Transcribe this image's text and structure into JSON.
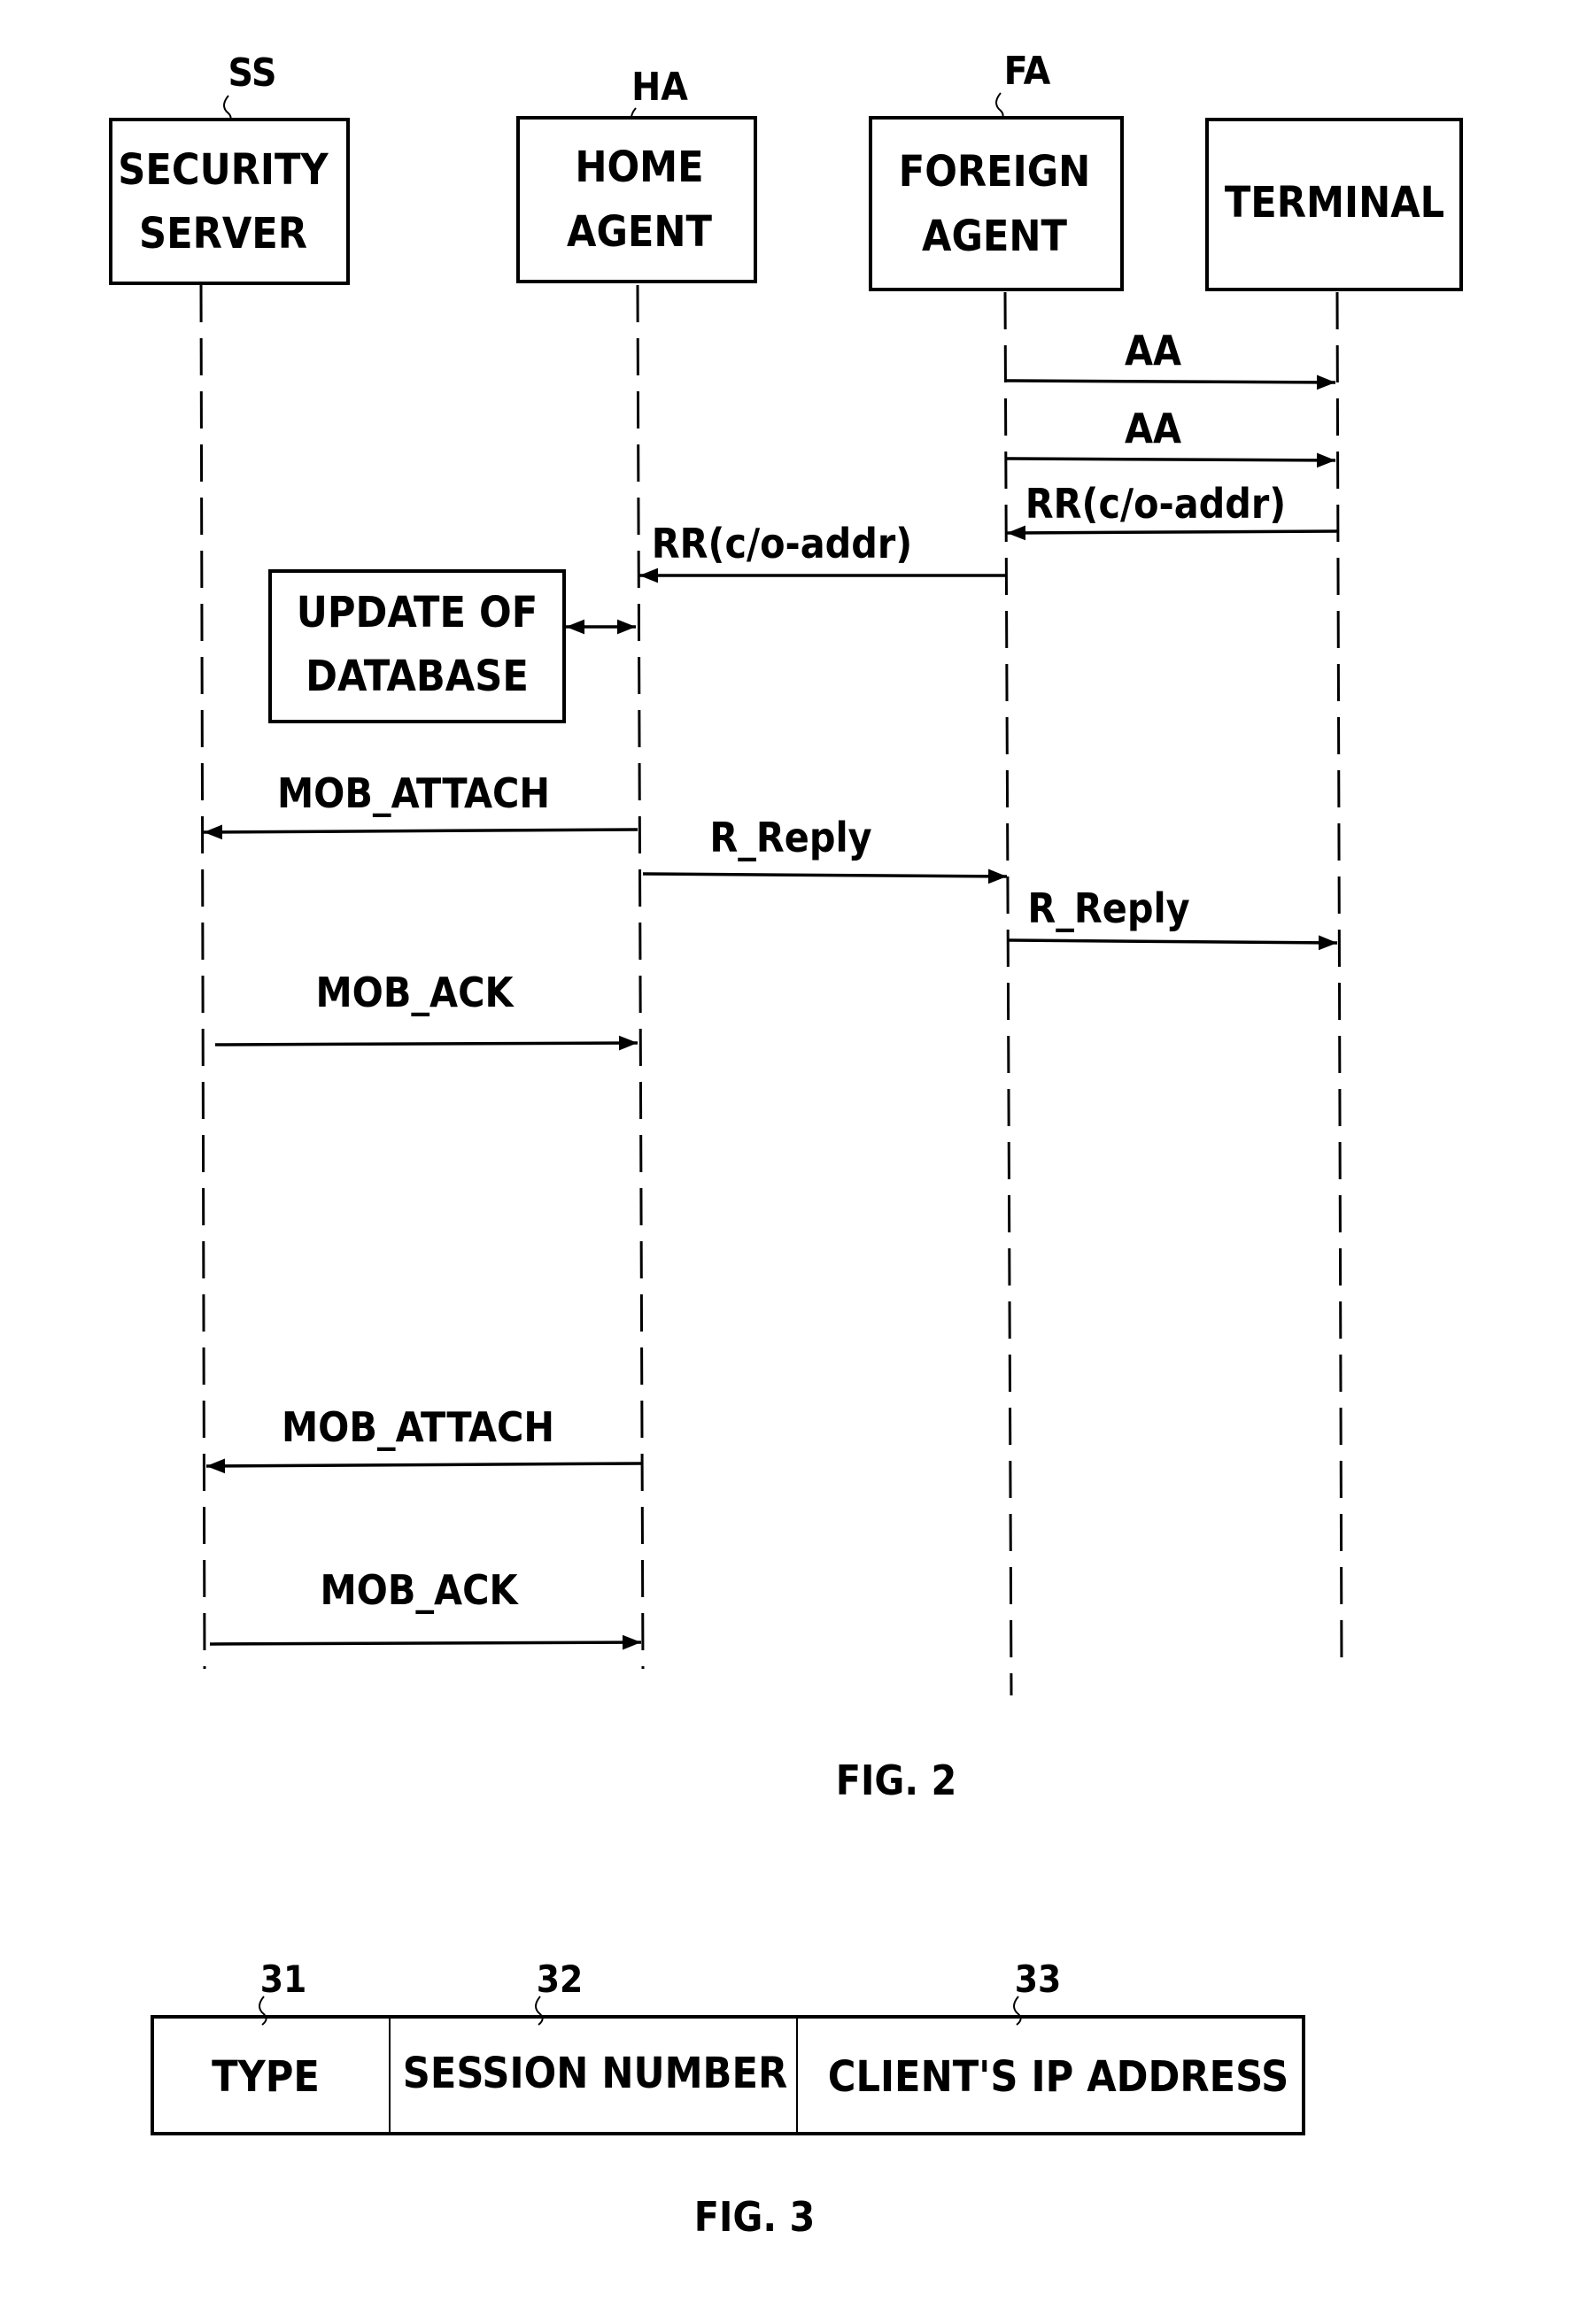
{
  "fig2": {
    "caption": "FIG. 2",
    "entities": [
      {
        "id": "ss",
        "ref": "SS",
        "lines": [
          "SECURITY",
          "SERVER"
        ]
      },
      {
        "id": "ha",
        "ref": "HA",
        "lines": [
          "HOME",
          "AGENT"
        ]
      },
      {
        "id": "fa",
        "ref": "FA",
        "lines": [
          "FOREIGN",
          "AGENT"
        ]
      },
      {
        "id": "terminal",
        "ref": "",
        "lines": [
          "TERMINAL"
        ]
      }
    ],
    "database_box": {
      "lines": [
        "UPDATE OF",
        "DATABASE"
      ],
      "connects_to": "ha"
    },
    "messages": [
      {
        "label": "AA",
        "from": "fa",
        "to": "terminal"
      },
      {
        "label": "AA",
        "from": "fa",
        "to": "terminal"
      },
      {
        "label": "RR(c/o-addr)",
        "from": "terminal",
        "to": "fa"
      },
      {
        "label": "RR(c/o-addr)",
        "from": "fa",
        "to": "ha"
      },
      {
        "label": "MOB_ATTACH",
        "from": "ha",
        "to": "ss"
      },
      {
        "label": "R_Reply",
        "from": "ha",
        "to": "fa"
      },
      {
        "label": "R_Reply",
        "from": "fa",
        "to": "terminal"
      },
      {
        "label": "MOB_ACK",
        "from": "ss",
        "to": "ha"
      },
      {
        "label": "MOB_ATTACH",
        "from": "ha",
        "to": "ss"
      },
      {
        "label": "MOB_ACK",
        "from": "ss",
        "to": "ha"
      }
    ]
  },
  "fig3": {
    "caption": "FIG. 3",
    "fields": [
      {
        "ref": "31",
        "label": "TYPE"
      },
      {
        "ref": "32",
        "label": "SESSION NUMBER"
      },
      {
        "ref": "33",
        "label": "CLIENT'S IP ADDRESS"
      }
    ]
  }
}
